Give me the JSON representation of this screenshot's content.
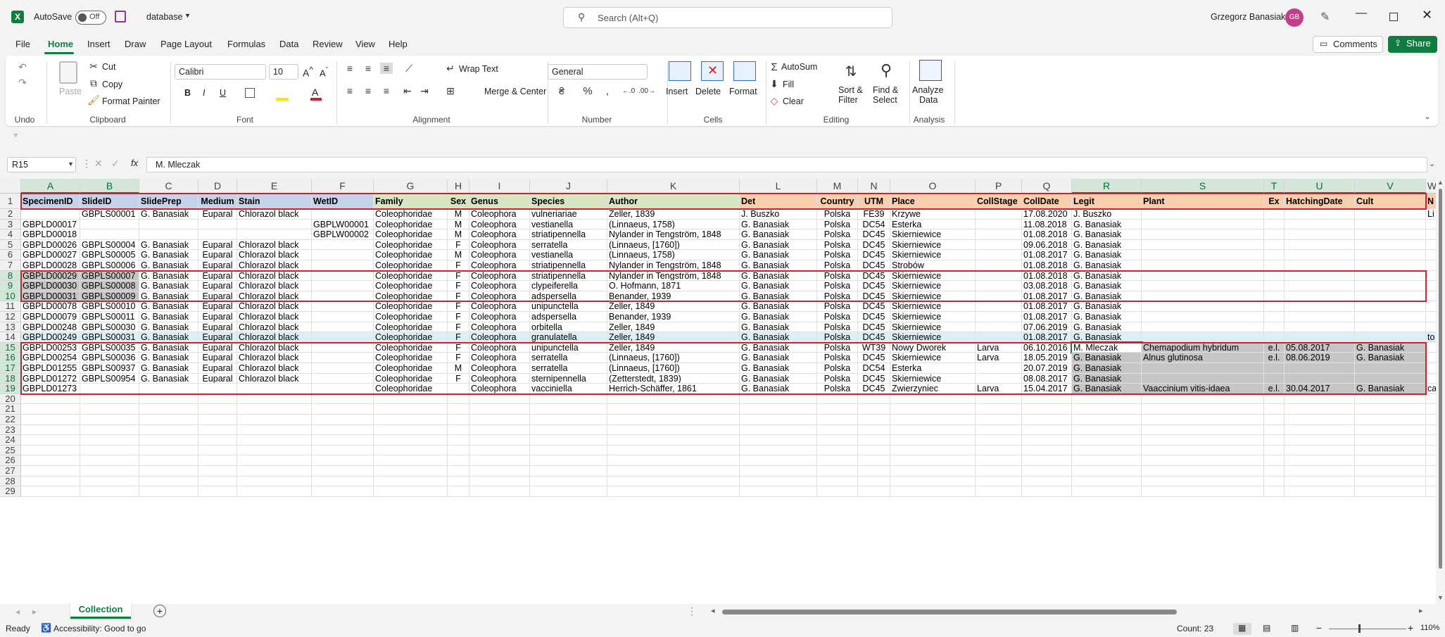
{
  "titlebar": {
    "autosave_label": "AutoSave",
    "autosave_state": "Off",
    "filename": "database",
    "search_placeholder": "Search (Alt+Q)",
    "username": "Grzegorz Banasiak",
    "avatar_initials": "GB",
    "icons": [
      "excel-logo",
      "save-icon",
      "search-icon",
      "pen-icon",
      "minimize-icon",
      "maximize-icon",
      "close-icon"
    ]
  },
  "menu": {
    "items": [
      "File",
      "Home",
      "Insert",
      "Draw",
      "Page Layout",
      "Formulas",
      "Data",
      "Review",
      "View",
      "Help"
    ],
    "active": "Home",
    "comments_label": "Comments",
    "share_label": "Share"
  },
  "ribbon": {
    "undo_group": "Undo",
    "clipboard": {
      "group": "Clipboard",
      "paste": "Paste",
      "cut": "Cut",
      "copy": "Copy",
      "format_painter": "Format Painter"
    },
    "font": {
      "group": "Font",
      "name": "Calibri",
      "size": "10",
      "bold": "B",
      "italic": "I",
      "underline": "U"
    },
    "alignment": {
      "group": "Alignment",
      "wrap_text": "Wrap Text",
      "merge_center": "Merge & Center"
    },
    "number": {
      "group": "Number",
      "format": "General"
    },
    "cells": {
      "group": "Cells",
      "insert": "Insert",
      "delete": "Delete",
      "format": "Format"
    },
    "editing": {
      "group": "Editing",
      "autosum": "AutoSum",
      "fill": "Fill",
      "clear": "Clear",
      "sort_filter_1": "Sort &",
      "sort_filter_2": "Filter",
      "find_select_1": "Find &",
      "find_select_2": "Select"
    },
    "analysis": {
      "group": "Analysis",
      "analyze_1": "Analyze",
      "analyze_2": "Data"
    }
  },
  "formula_bar": {
    "cell_ref": "R15",
    "fx": "fx",
    "content": "M. Mleczak"
  },
  "grid": {
    "columns": [
      {
        "letter": "A",
        "w": 84
      },
      {
        "letter": "B",
        "w": 84
      },
      {
        "letter": "C",
        "w": 84
      },
      {
        "letter": "D",
        "w": 55
      },
      {
        "letter": "E",
        "w": 106
      },
      {
        "letter": "F",
        "w": 88
      },
      {
        "letter": "G",
        "w": 105
      },
      {
        "letter": "H",
        "w": 31
      },
      {
        "letter": "I",
        "w": 86
      },
      {
        "letter": "J",
        "w": 110
      },
      {
        "letter": "K",
        "w": 188
      },
      {
        "letter": "L",
        "w": 110
      },
      {
        "letter": "M",
        "w": 58
      },
      {
        "letter": "N",
        "w": 46
      },
      {
        "letter": "O",
        "w": 121
      },
      {
        "letter": "P",
        "w": 66
      },
      {
        "letter": "Q",
        "w": 71
      },
      {
        "letter": "R",
        "w": 99
      },
      {
        "letter": "S",
        "w": 174
      },
      {
        "letter": "T",
        "w": 29
      },
      {
        "letter": "U",
        "w": 100
      },
      {
        "letter": "V",
        "w": 101
      },
      {
        "letter": "W",
        "w": 18
      }
    ],
    "header_colors": [
      "#c5d3ea",
      "#c5d3ea",
      "#c5d3ea",
      "#c5d3ea",
      "#c5d3ea",
      "#c5d3ea",
      "#d7e6c2",
      "#d7e6c2",
      "#d7e6c2",
      "#d7e6c2",
      "#d7e6c2",
      "#f8cfae",
      "#f8cfae",
      "#f8cfae",
      "#f8cfae",
      "#f8cfae",
      "#f8cfae",
      "#f8cfae",
      "#f8cfae",
      "#f8cfae",
      "#f8cfae",
      "#f8cfae",
      "#f8cfae"
    ],
    "selected_cols": [
      "A",
      "B",
      "R",
      "S",
      "T",
      "U",
      "V"
    ],
    "selected_rows": [
      8,
      9,
      10,
      15,
      16,
      17,
      18,
      19
    ],
    "headers": [
      "SpecimenID",
      "SlideID",
      "SlidePrep",
      "Medium",
      "Stain",
      "WetID",
      "Family",
      "Sex",
      "Genus",
      "Species",
      "Author",
      "Det",
      "Country",
      "UTM",
      "Place",
      "CollStage",
      "CollDate",
      "Legit",
      "Plant",
      "Ex",
      "HatchingDate",
      "Cult",
      "N"
    ],
    "rows": [
      [
        "",
        "GBPLS00001",
        "G. Banasiak",
        "Euparal",
        "Chlorazol black",
        "",
        "Coleophoridae",
        "M",
        "Coleophora",
        "vulneriariae",
        "Zeller, 1839",
        "J. Buszko",
        "Polska",
        "FE39",
        "Krzywe",
        "",
        "17.08.2020",
        "J. Buszko",
        "",
        "",
        "",
        "",
        "Li"
      ],
      [
        "GBPLD00017",
        "",
        "",
        "",
        "",
        "GBPLW00001",
        "Coleophoridae",
        "M",
        "Coleophora",
        "vestianella",
        "(Linnaeus, 1758)",
        "G. Banasiak",
        "Polska",
        "DC54",
        "Esterka",
        "",
        "11.08.2018",
        "G. Banasiak",
        "",
        "",
        "",
        "",
        ""
      ],
      [
        "GBPLD00018",
        "",
        "",
        "",
        "",
        "GBPLW00002",
        "Coleophoridae",
        "M",
        "Coleophora",
        "striatipennella",
        "Nylander in Tengström, 1848",
        "G. Banasiak",
        "Polska",
        "DC45",
        "Skierniewice",
        "",
        "01.08.2018",
        "G. Banasiak",
        "",
        "",
        "",
        "",
        ""
      ],
      [
        "GBPLD00026",
        "GBPLS00004",
        "G. Banasiak",
        "Euparal",
        "Chlorazol black",
        "",
        "Coleophoridae",
        "F",
        "Coleophora",
        "serratella",
        "(Linnaeus, [1760])",
        "G. Banasiak",
        "Polska",
        "DC45",
        "Skierniewice",
        "",
        "09.06.2018",
        "G. Banasiak",
        "",
        "",
        "",
        "",
        ""
      ],
      [
        "GBPLD00027",
        "GBPLS00005",
        "G. Banasiak",
        "Euparal",
        "Chlorazol black",
        "",
        "Coleophoridae",
        "M",
        "Coleophora",
        "vestianella",
        "(Linnaeus, 1758)",
        "G. Banasiak",
        "Polska",
        "DC45",
        "Skierniewice",
        "",
        "01.08.2017",
        "G. Banasiak",
        "",
        "",
        "",
        "",
        ""
      ],
      [
        "GBPLD00028",
        "GBPLS00006",
        "G. Banasiak",
        "Euparal",
        "Chlorazol black",
        "",
        "Coleophoridae",
        "F",
        "Coleophora",
        "striatipennella",
        "Nylander in Tengström, 1848",
        "G. Banasiak",
        "Polska",
        "DC45",
        "Strobów",
        "",
        "01.08.2018",
        "G. Banasiak",
        "",
        "",
        "",
        "",
        ""
      ],
      [
        "GBPLD00029",
        "GBPLS00007",
        "G. Banasiak",
        "Euparal",
        "Chlorazol black",
        "",
        "Coleophoridae",
        "F",
        "Coleophora",
        "striatipennella",
        "Nylander in Tengström, 1848",
        "G. Banasiak",
        "Polska",
        "DC45",
        "Skierniewice",
        "",
        "01.08.2018",
        "G. Banasiak",
        "",
        "",
        "",
        "",
        ""
      ],
      [
        "GBPLD00030",
        "GBPLS00008",
        "G. Banasiak",
        "Euparal",
        "Chlorazol black",
        "",
        "Coleophoridae",
        "F",
        "Coleophora",
        "clypeiferella",
        "O. Hofmann, 1871",
        "G. Banasiak",
        "Polska",
        "DC45",
        "Skierniewice",
        "",
        "03.08.2018",
        "G. Banasiak",
        "",
        "",
        "",
        "",
        ""
      ],
      [
        "GBPLD00031",
        "GBPLS00009",
        "G. Banasiak",
        "Euparal",
        "Chlorazol black",
        "",
        "Coleophoridae",
        "F",
        "Coleophora",
        "adspersella",
        "Benander, 1939",
        "G. Banasiak",
        "Polska",
        "DC45",
        "Skierniewice",
        "",
        "01.08.2017",
        "G. Banasiak",
        "",
        "",
        "",
        "",
        ""
      ],
      [
        "GBPLD00078",
        "GBPLS00010",
        "G. Banasiak",
        "Euparal",
        "Chlorazol black",
        "",
        "Coleophoridae",
        "F",
        "Coleophora",
        "unipunctella",
        "Zeller, 1849",
        "G. Banasiak",
        "Polska",
        "DC45",
        "Skierniewice",
        "",
        "01.08.2017",
        "G. Banasiak",
        "",
        "",
        "",
        "",
        ""
      ],
      [
        "GBPLD00079",
        "GBPLS00011",
        "G. Banasiak",
        "Euparal",
        "Chlorazol black",
        "",
        "Coleophoridae",
        "F",
        "Coleophora",
        "adspersella",
        "Benander, 1939",
        "G. Banasiak",
        "Polska",
        "DC45",
        "Skierniewice",
        "",
        "01.08.2017",
        "G. Banasiak",
        "",
        "",
        "",
        "",
        ""
      ],
      [
        "GBPLD00248",
        "GBPLS00030",
        "G. Banasiak",
        "Euparal",
        "Chlorazol black",
        "",
        "Coleophoridae",
        "F",
        "Coleophora",
        "orbitella",
        "Zeller, 1849",
        "G. Banasiak",
        "Polska",
        "DC45",
        "Skierniewice",
        "",
        "07.06.2019",
        "G. Banasiak",
        "",
        "",
        "",
        "",
        ""
      ],
      [
        "GBPLD00249",
        "GBPLS00031",
        "G. Banasiak",
        "Euparal",
        "Chlorazol black",
        "",
        "Coleophoridae",
        "F",
        "Coleophora",
        "granulatella",
        "Zeller, 1849",
        "G. Banasiak",
        "Polska",
        "DC45",
        "Skierniewice",
        "",
        "01.08.2017",
        "G. Banasiak",
        "",
        "",
        "",
        "",
        "to"
      ],
      [
        "GBPLD00253",
        "GBPLS00035",
        "G. Banasiak",
        "Euparal",
        "Chlorazol black",
        "",
        "Coleophoridae",
        "F",
        "Coleophora",
        "unipunctella",
        "Zeller, 1849",
        "G. Banasiak",
        "Polska",
        "WT39",
        "Nowy Dworek",
        "Larva",
        "06.10.2016",
        "M. Mleczak",
        "Chemapodium hybridum",
        "e.l.",
        "05.08.2017",
        "G. Banasiak",
        ""
      ],
      [
        "GBPLD00254",
        "GBPLS00036",
        "G. Banasiak",
        "Euparal",
        "Chlorazol black",
        "",
        "Coleophoridae",
        "F",
        "Coleophora",
        "serratella",
        "(Linnaeus, [1760])",
        "G. Banasiak",
        "Polska",
        "DC45",
        "Skierniewice",
        "Larva",
        "18.05.2019",
        "G. Banasiak",
        "Alnus glutinosa",
        "e.l.",
        "08.06.2019",
        "G. Banasiak",
        ""
      ],
      [
        "GBPLD01255",
        "GBPLS00937",
        "G. Banasiak",
        "Euparal",
        "Chlorazol black",
        "",
        "Coleophoridae",
        "M",
        "Coleophora",
        "serratella",
        "(Linnaeus, [1760])",
        "G. Banasiak",
        "Polska",
        "DC54",
        "Esterka",
        "",
        "20.07.2019",
        "G. Banasiak",
        "",
        "",
        "",
        "",
        ""
      ],
      [
        "GBPLD01272",
        "GBPLS00954",
        "G. Banasiak",
        "Euparal",
        "Chlorazol black",
        "",
        "Coleophoridae",
        "F",
        "Coleophora",
        "sternipennella",
        "(Zetterstedt, 1839)",
        "G. Banasiak",
        "Polska",
        "DC45",
        "Skierniewice",
        "",
        "08.08.2017",
        "G. Banasiak",
        "",
        "",
        "",
        "",
        ""
      ],
      [
        "GBPLD01273",
        "",
        "",
        "",
        "",
        "",
        "Coleophoridae",
        "",
        "Coleophora",
        "vacciniella",
        "Herrich-Schäffer, 1861",
        "G. Banasiak",
        "Polska",
        "DC45",
        "Zwierzyniec",
        "Larva",
        "15.04.2017",
        "G. Banasiak",
        "Vaaccinium vitis-idaea",
        "e.l.",
        "30.04.2017",
        "G. Banasiak",
        "ca"
      ]
    ],
    "total_rows": 29
  },
  "sheet_tabs": {
    "active": "Collection",
    "add_icon": "+"
  },
  "status": {
    "ready": "Ready",
    "accessibility": "Accessibility: Good to go",
    "count": "Count: 23",
    "zoom": "110%"
  }
}
